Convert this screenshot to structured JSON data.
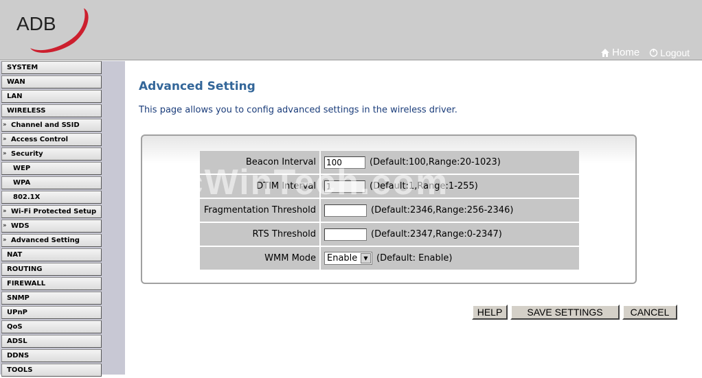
{
  "header": {
    "logo_text": "ADB",
    "home_label": "Home",
    "logout_label": "Logout"
  },
  "sidebar": {
    "items": [
      {
        "label": "SYSTEM",
        "level": 0
      },
      {
        "label": "WAN",
        "level": 0
      },
      {
        "label": "LAN",
        "level": 0
      },
      {
        "label": "WIRELESS",
        "level": 0
      },
      {
        "label": "Channel and SSID",
        "level": 1
      },
      {
        "label": "Access Control",
        "level": 1
      },
      {
        "label": "Security",
        "level": 1
      },
      {
        "label": "WEP",
        "level": 2
      },
      {
        "label": "WPA",
        "level": 2
      },
      {
        "label": "802.1X",
        "level": 2
      },
      {
        "label": "Wi-Fi Protected Setup",
        "level": 1
      },
      {
        "label": "WDS",
        "level": 1
      },
      {
        "label": "Advanced Setting",
        "level": 1
      },
      {
        "label": "NAT",
        "level": 0
      },
      {
        "label": "ROUTING",
        "level": 0
      },
      {
        "label": "FIREWALL",
        "level": 0
      },
      {
        "label": "SNMP",
        "level": 0
      },
      {
        "label": "UPnP",
        "level": 0
      },
      {
        "label": "QoS",
        "level": 0
      },
      {
        "label": "ADSL",
        "level": 0
      },
      {
        "label": "DDNS",
        "level": 0
      },
      {
        "label": "TOOLS",
        "level": 0
      }
    ]
  },
  "main": {
    "title": "Advanced Setting",
    "description": "This page allows you to config advanced settings in the wireless driver.",
    "fields": {
      "beacon": {
        "label": "Beacon Interval",
        "value": "100",
        "hint": "(Default:100,Range:20-1023)"
      },
      "dtim": {
        "label": "DTIM Interval",
        "value": "1",
        "hint": "(Default:1,Range:1-255)"
      },
      "frag": {
        "label": "Fragmentation Threshold",
        "value": "",
        "hint": "(Default:2346,Range:256-2346)"
      },
      "rts": {
        "label": "RTS Threshold",
        "value": "",
        "hint": "(Default:2347,Range:0-2347)"
      },
      "wmm": {
        "label": "WMM Mode",
        "value": "Enable",
        "hint": "(Default: Enable)"
      }
    },
    "buttons": {
      "help": "HELP",
      "save": "SAVE SETTINGS",
      "cancel": "CANCEL"
    }
  },
  "watermark": "PcWinTech.com",
  "colors": {
    "header_bg": "#cccccc",
    "sidebar_bg": "#c8c8d4",
    "title": "#336699",
    "logo_red": "#cc1f2e"
  }
}
